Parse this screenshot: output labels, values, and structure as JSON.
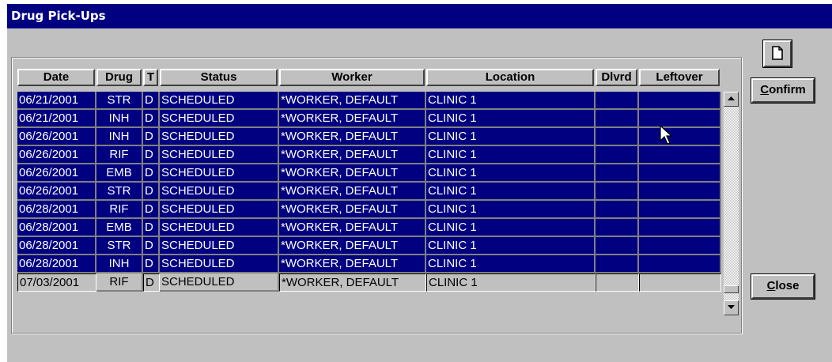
{
  "window": {
    "title": "Drug Pick-Ups"
  },
  "table": {
    "columns": [
      "Date",
      "Drug",
      "T",
      "Status",
      "Worker",
      "Location",
      "Dlvrd",
      "Leftover"
    ],
    "rows": [
      {
        "date": "06/21/2001",
        "drug": "STR",
        "t": "D",
        "status": "SCHEDULED",
        "worker": "*WORKER, DEFAULT",
        "location": "CLINIC 1",
        "dlvrd": "",
        "leftover": "",
        "selected": true
      },
      {
        "date": "06/21/2001",
        "drug": "INH",
        "t": "D",
        "status": "SCHEDULED",
        "worker": "*WORKER, DEFAULT",
        "location": "CLINIC 1",
        "dlvrd": "",
        "leftover": "",
        "selected": true
      },
      {
        "date": "06/26/2001",
        "drug": "INH",
        "t": "D",
        "status": "SCHEDULED",
        "worker": "*WORKER, DEFAULT",
        "location": "CLINIC 1",
        "dlvrd": "",
        "leftover": "",
        "selected": true
      },
      {
        "date": "06/26/2001",
        "drug": "RIF",
        "t": "D",
        "status": "SCHEDULED",
        "worker": "*WORKER, DEFAULT",
        "location": "CLINIC 1",
        "dlvrd": "",
        "leftover": "",
        "selected": true
      },
      {
        "date": "06/26/2001",
        "drug": "EMB",
        "t": "D",
        "status": "SCHEDULED",
        "worker": "*WORKER, DEFAULT",
        "location": "CLINIC 1",
        "dlvrd": "",
        "leftover": "",
        "selected": true
      },
      {
        "date": "06/26/2001",
        "drug": "STR",
        "t": "D",
        "status": "SCHEDULED",
        "worker": "*WORKER, DEFAULT",
        "location": "CLINIC 1",
        "dlvrd": "",
        "leftover": "",
        "selected": true
      },
      {
        "date": "06/28/2001",
        "drug": "RIF",
        "t": "D",
        "status": "SCHEDULED",
        "worker": "*WORKER, DEFAULT",
        "location": "CLINIC 1",
        "dlvrd": "",
        "leftover": "",
        "selected": true
      },
      {
        "date": "06/28/2001",
        "drug": "EMB",
        "t": "D",
        "status": "SCHEDULED",
        "worker": "*WORKER, DEFAULT",
        "location": "CLINIC 1",
        "dlvrd": "",
        "leftover": "",
        "selected": true
      },
      {
        "date": "06/28/2001",
        "drug": "STR",
        "t": "D",
        "status": "SCHEDULED",
        "worker": "*WORKER, DEFAULT",
        "location": "CLINIC 1",
        "dlvrd": "",
        "leftover": "",
        "selected": true
      },
      {
        "date": "06/28/2001",
        "drug": "INH",
        "t": "D",
        "status": "SCHEDULED",
        "worker": "*WORKER, DEFAULT",
        "location": "CLINIC 1",
        "dlvrd": "",
        "leftover": "",
        "selected": true
      },
      {
        "date": "07/03/2001",
        "drug": "RIF",
        "t": "D",
        "status": "SCHEDULED",
        "worker": "*WORKER, DEFAULT",
        "location": "CLINIC 1",
        "dlvrd": "",
        "leftover": "",
        "selected": false
      }
    ]
  },
  "buttons": {
    "new_icon": "document-icon",
    "confirm": {
      "accel": "C",
      "rest": "onfirm"
    },
    "close": {
      "accel": "C",
      "rest": "lose"
    }
  },
  "icons": {
    "scroll_up": "arrow-up-icon",
    "scroll_down": "arrow-down-icon",
    "cursor": "mouse-pointer-icon"
  },
  "colors": {
    "title_bar": "#000080",
    "selection": "#000080",
    "face": "#c0c0c0"
  }
}
